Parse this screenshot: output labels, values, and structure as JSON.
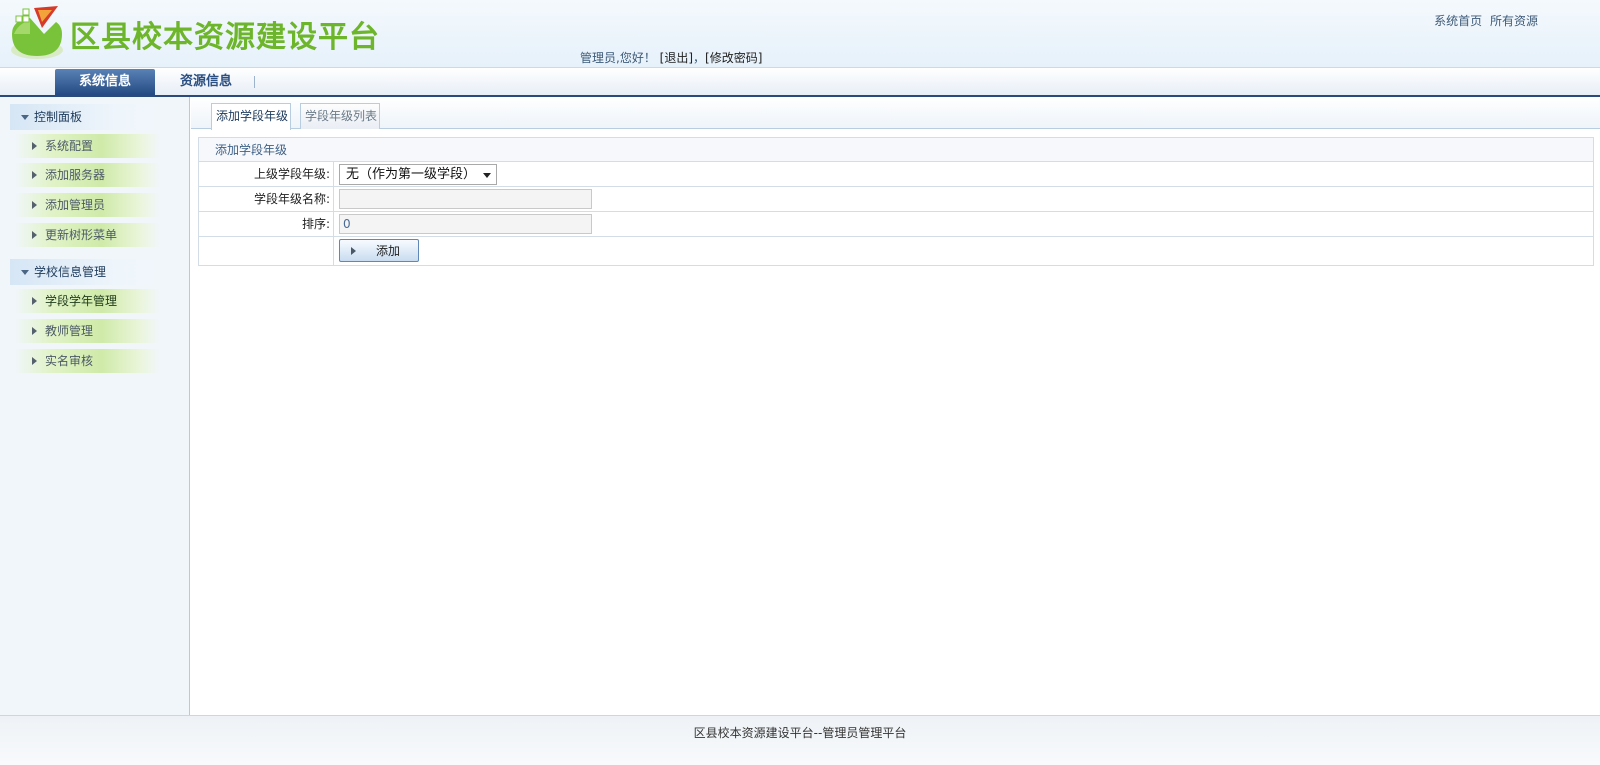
{
  "header": {
    "title": "区县校本资源建设平台",
    "top_links": [
      "系统首页",
      "所有资源"
    ],
    "greeting": "管理员,您好！",
    "logout": "[退出]",
    "separator": "，",
    "change_password": "[修改密码]"
  },
  "nav": {
    "tabs": [
      {
        "label": "系统信息",
        "active": true
      },
      {
        "label": "资源信息",
        "active": false
      }
    ]
  },
  "sidebar": {
    "groups": [
      {
        "title": "控制面板",
        "items": [
          {
            "label": "系统配置"
          },
          {
            "label": "添加服务器"
          },
          {
            "label": "添加管理员"
          },
          {
            "label": "更新树形菜单"
          }
        ]
      },
      {
        "title": "学校信息管理",
        "items": [
          {
            "label": "学段学年管理"
          },
          {
            "label": "教师管理"
          },
          {
            "label": "实名审核"
          }
        ]
      }
    ]
  },
  "main": {
    "tabs": [
      {
        "label": "添加学段年级",
        "active": true
      },
      {
        "label": "学段年级列表",
        "active": false
      }
    ],
    "form": {
      "title": "添加学段年级",
      "parent_label": "上级学段年级:",
      "parent_value": "无（作为第一级学段）",
      "name_label": "学段年级名称:",
      "name_value": "",
      "order_label": "排序:",
      "order_value": "0",
      "submit_label": "添加"
    }
  },
  "footer": {
    "text": "区县校本资源建设平台--管理员管理平台"
  },
  "colors": {
    "brand_green": "#6db52a",
    "nav_blue": "#254a83"
  }
}
